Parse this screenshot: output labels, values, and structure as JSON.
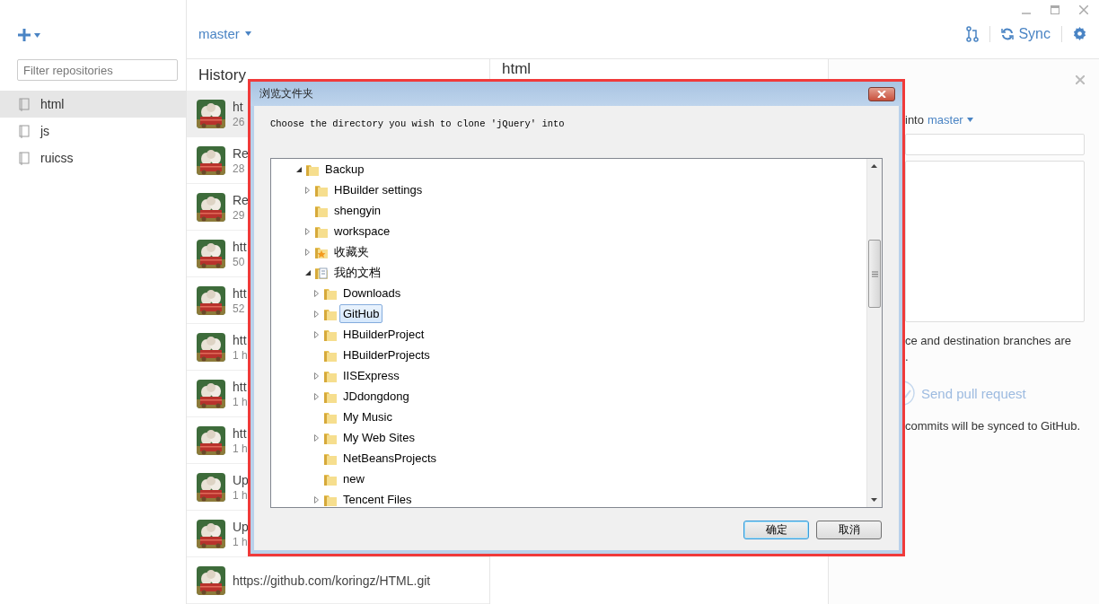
{
  "toolbar": {
    "branch": "master",
    "sync_label": "Sync"
  },
  "sidebar": {
    "filter_placeholder": "Filter repositories",
    "repositories": [
      {
        "name": "html",
        "selected": true
      },
      {
        "name": "js",
        "selected": false
      },
      {
        "name": "ruicss",
        "selected": false
      }
    ]
  },
  "history": {
    "title": "History",
    "commits": [
      {
        "title": "ht",
        "meta": "26",
        "selected": true
      },
      {
        "title": "Re",
        "meta": "28",
        "selected": false
      },
      {
        "title": "Re",
        "meta": "29",
        "selected": false
      },
      {
        "title": "htt",
        "meta": "50",
        "selected": false
      },
      {
        "title": "htt",
        "meta": "52",
        "selected": false
      },
      {
        "title": "htt",
        "meta": "1 h",
        "selected": false
      },
      {
        "title": "htt",
        "meta": "1 h",
        "selected": false
      },
      {
        "title": "htt",
        "meta": "1 h",
        "selected": false
      },
      {
        "title": "Up",
        "meta": "1 h",
        "selected": false
      },
      {
        "title": "Up",
        "meta": "1 h",
        "selected": false
      },
      {
        "title": "https://github.com/koringz/HTML.git",
        "selected": false
      }
    ]
  },
  "detail": {
    "title": "html"
  },
  "pull_request": {
    "into_label": "into",
    "branch": "master",
    "note": "ce and destination branches are",
    "note_end": ".",
    "send_label": "Send pull request",
    "send_disabled": true,
    "footer": "commits will be synced to GitHub."
  },
  "dialog": {
    "title": "浏览文件夹",
    "prompt": "Choose the directory you wish to clone 'jQuery' into",
    "tree": [
      {
        "label": "Backup",
        "kind": "folder",
        "expandable": true,
        "expanded": true,
        "selected": false,
        "children": [
          {
            "label": "HBuilder settings",
            "kind": "folder",
            "expandable": true,
            "expanded": false,
            "selected": false
          },
          {
            "label": "shengyin",
            "kind": "folder",
            "expandable": false,
            "selected": false
          },
          {
            "label": "workspace",
            "kind": "folder",
            "expandable": true,
            "expanded": false,
            "selected": false
          },
          {
            "label": "收藏夹",
            "kind": "favorites",
            "expandable": true,
            "expanded": false,
            "selected": false
          },
          {
            "label": "我的文档",
            "kind": "documents",
            "expandable": true,
            "expanded": true,
            "selected": false,
            "children": [
              {
                "label": "Downloads",
                "kind": "folder",
                "expandable": true,
                "expanded": false,
                "selected": false
              },
              {
                "label": "GitHub",
                "kind": "folder",
                "expandable": true,
                "expanded": false,
                "selected": true
              },
              {
                "label": "HBuilderProject",
                "kind": "folder",
                "expandable": true,
                "expanded": false,
                "selected": false
              },
              {
                "label": "HBuilderProjects",
                "kind": "folder",
                "expandable": false,
                "selected": false
              },
              {
                "label": "IISExpress",
                "kind": "folder",
                "expandable": true,
                "expanded": false,
                "selected": false
              },
              {
                "label": "JDdongdong",
                "kind": "folder",
                "expandable": true,
                "expanded": false,
                "selected": false
              },
              {
                "label": "My Music",
                "kind": "folder",
                "expandable": false,
                "selected": false
              },
              {
                "label": "My Web Sites",
                "kind": "folder",
                "expandable": true,
                "expanded": false,
                "selected": false
              },
              {
                "label": "NetBeansProjects",
                "kind": "folder",
                "expandable": false,
                "selected": false
              },
              {
                "label": "new",
                "kind": "folder",
                "expandable": false,
                "selected": false
              },
              {
                "label": "Tencent Files",
                "kind": "folder",
                "expandable": true,
                "expanded": false,
                "selected": false
              }
            ]
          }
        ]
      }
    ],
    "buttons": [
      {
        "label": "确定",
        "default": true
      },
      {
        "label": "取消",
        "default": false
      }
    ]
  }
}
